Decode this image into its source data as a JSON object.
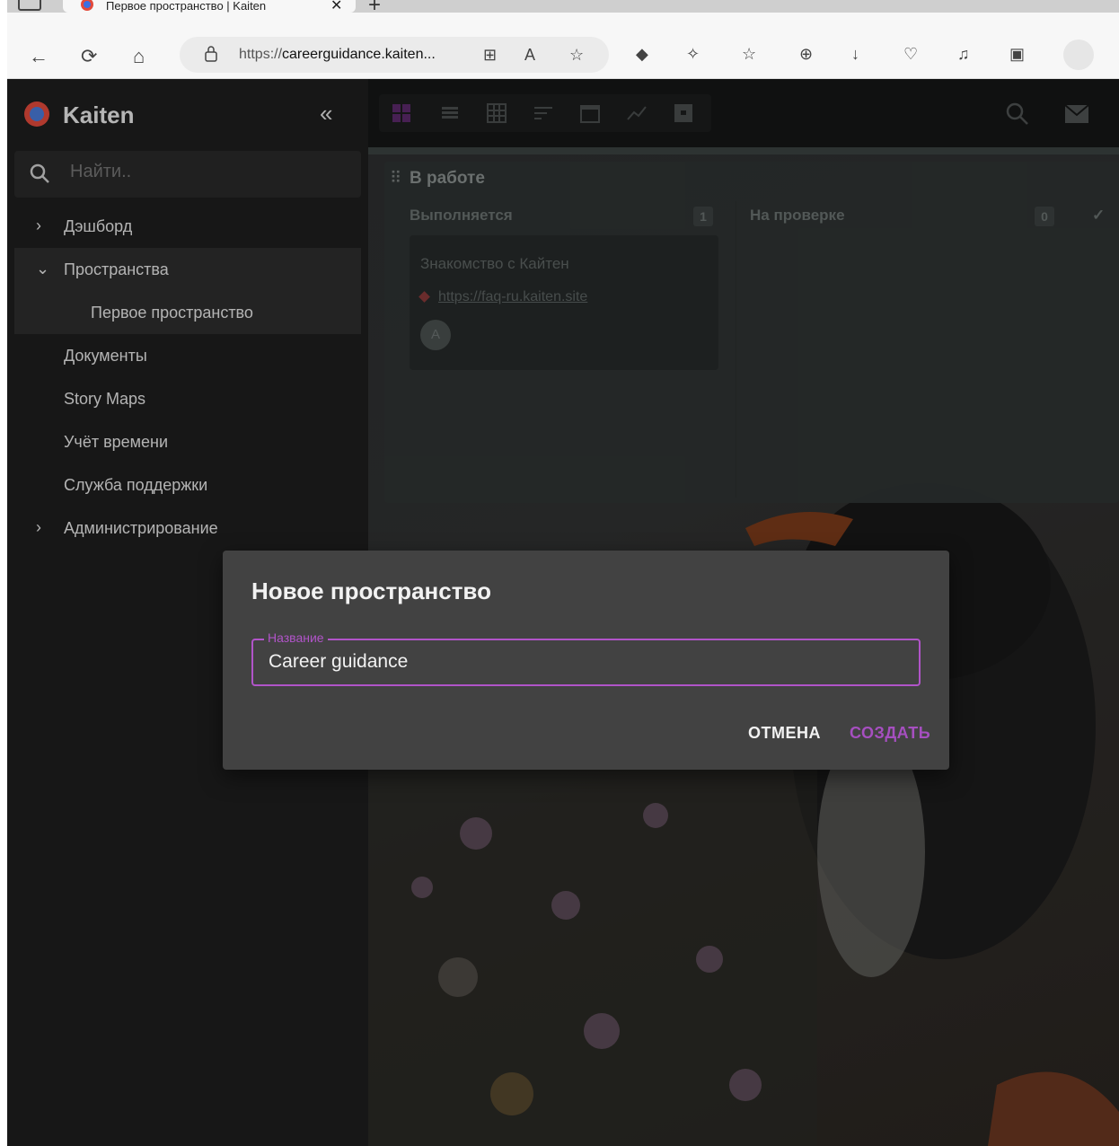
{
  "browser": {
    "tab_title": "Первое пространство | Kaiten",
    "tab_close": "✕",
    "new_tab": "+",
    "url_scheme": "https://",
    "url_host": "careerguidance.kaiten...",
    "back_icon": "←",
    "refresh_icon": "⟳",
    "home_icon": "⌂"
  },
  "sidebar": {
    "logo_text": "Kaiten",
    "collapse_label": "«",
    "search_placeholder": "Найти..",
    "items": [
      {
        "label": "Дэшборд",
        "chevron": "›",
        "type": "group"
      },
      {
        "label": "Пространства",
        "chevron": "⌄",
        "type": "group-open"
      },
      {
        "label": "Первое пространство",
        "type": "sub"
      },
      {
        "label": "Документы",
        "type": "item"
      },
      {
        "label": "Story Maps",
        "type": "item"
      },
      {
        "label": "Учёт времени",
        "type": "item"
      },
      {
        "label": "Служба поддержки",
        "type": "item"
      },
      {
        "label": "Администрирование",
        "chevron": "›",
        "type": "group"
      }
    ]
  },
  "board": {
    "grip": "⠿",
    "title": "В работе",
    "columns": [
      {
        "title": "Выполняется",
        "count": "1"
      },
      {
        "title": "На проверке",
        "count": "0"
      }
    ],
    "card": {
      "title": "Знакомство с Кайтен",
      "link": "https://faq-ru.kaiten.site",
      "avatar": "A"
    }
  },
  "dialog": {
    "title": "Новое пространство",
    "field_label": "Название",
    "field_value": "Career guidance",
    "cancel_label": "ОТМЕНА",
    "create_label": "СОЗДАТЬ"
  },
  "colors": {
    "accent": "#b154c9",
    "dialog_bg": "#424242",
    "sidebar_bg": "#1e1e1e"
  }
}
